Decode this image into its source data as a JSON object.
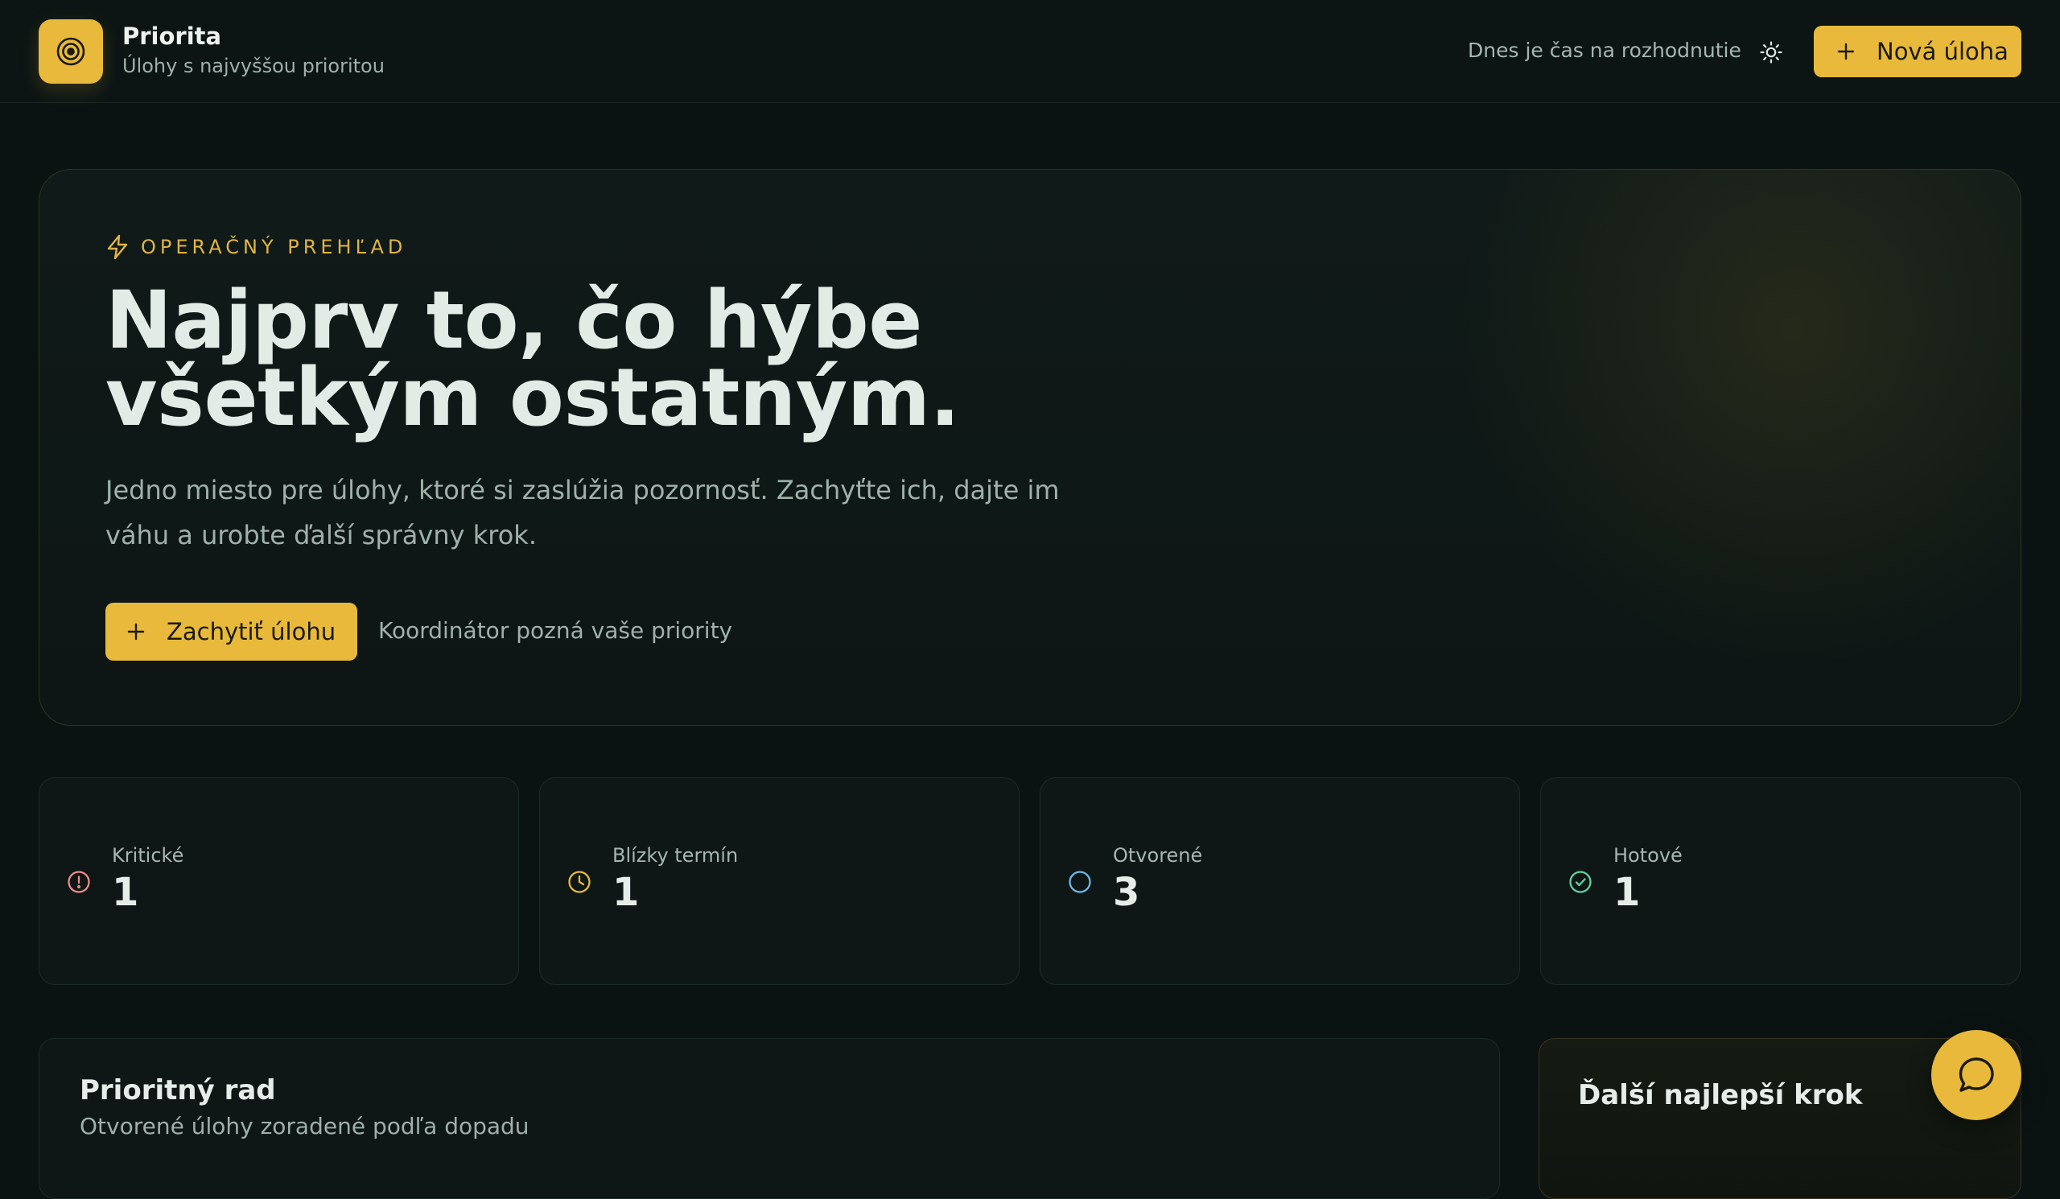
{
  "header": {
    "brand_title": "Priorita",
    "brand_subtitle": "Úlohy s najvyššou prioritou",
    "tagline": "Dnes je čas na rozhodnutie",
    "new_task_label": "Nová úloha",
    "logo_icon": "target-icon",
    "theme_icon": "sun-icon"
  },
  "hero": {
    "eyebrow": "OPERAČNÝ PREHĽAD",
    "title": "Najprv to, čo hýbe všetkým ostatným.",
    "description": "Jedno miesto pre úlohy, ktoré si zaslúžia pozornosť. Zachyťte ich, dajte im váhu a urobte ďalší správny krok.",
    "cta_label": "Zachytiť úlohu",
    "note": "Koordinátor pozná vaše priority"
  },
  "stats": [
    {
      "label": "Kritické",
      "value": "1",
      "icon": "alert-circle-icon",
      "color": "#f08a8a"
    },
    {
      "label": "Blízky termín",
      "value": "1",
      "icon": "clock-icon",
      "color": "#e8b93a"
    },
    {
      "label": "Otvorené",
      "value": "3",
      "icon": "circle-icon",
      "color": "#6fb8e6"
    },
    {
      "label": "Hotové",
      "value": "1",
      "icon": "check-circle-icon",
      "color": "#5fd3a0"
    }
  ],
  "queue": {
    "title": "Prioritný rad",
    "subtitle": "Otvorené úlohy zoradené podľa dopadu"
  },
  "next_step": {
    "title": "Ďalší najlepší krok"
  },
  "colors": {
    "accent": "#e8b93a",
    "background": "#0b1312"
  }
}
